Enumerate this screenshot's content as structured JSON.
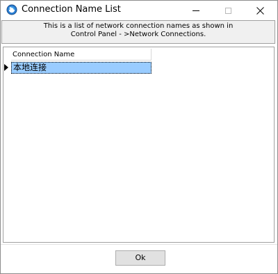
{
  "window": {
    "title": "Connection Name List",
    "icon": "globe-app-icon"
  },
  "title_buttons": {
    "minimize_icon": "minimize-icon",
    "maximize_icon": "maximize-icon",
    "close_icon": "close-icon",
    "maximize_enabled": false
  },
  "info": {
    "line1": "This is a list of network connection names as shown in",
    "line2": "Control Panel - >Network Connections."
  },
  "grid": {
    "columns": [
      "Connection Name"
    ],
    "rows": [
      {
        "name": "本地连接",
        "selected": true
      }
    ],
    "selection_color": "#99ccff"
  },
  "buttons": {
    "ok_label": "Ok"
  }
}
